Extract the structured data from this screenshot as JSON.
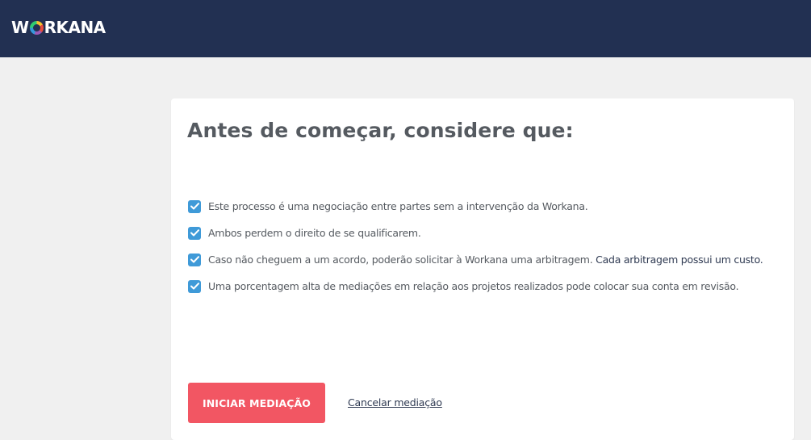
{
  "header": {
    "logo_w": "W",
    "logo_rest": "RKANA",
    "logo_alt": "WORKANA"
  },
  "card": {
    "title": "Antes de começar, considere que:",
    "items": [
      {
        "text": "Este processo é uma negociação entre partes sem a intervenção da Workana.",
        "checked": true
      },
      {
        "text": "Ambos perdem o direito de se qualificarem.",
        "checked": true
      },
      {
        "text": "Caso não cheguem a um acordo, poderão solicitar à Workana uma arbitragem. ",
        "link": "Cada arbitragem possui um custo.",
        "checked": true
      },
      {
        "text": "Uma porcentagem alta de mediações em relação aos projetos realizados pode colocar sua conta em revisão.",
        "checked": true
      }
    ],
    "primary_button": "INICIAR MEDIAÇÃO",
    "cancel_link": "Cancelar mediação"
  },
  "colors": {
    "header_bg": "#223052",
    "page_bg": "#f0f0f0",
    "checkbox": "#3f9ad8",
    "primary_button": "#f25663",
    "text": "#555a60",
    "link": "#2f3a52"
  },
  "icons": {
    "check": "checkmark-icon",
    "logo_o": "colorful-ring-icon"
  }
}
